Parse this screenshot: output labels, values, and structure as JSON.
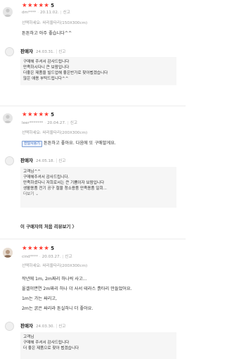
{
  "reviews": [
    {
      "stars": "★★★★★",
      "rating": "5",
      "user": "dm****",
      "date": "20.11.02.",
      "report": "신고",
      "option": "선택하세요: 싸리울타리(150X300cm)",
      "body": "튼튼하고 아주 좋습니다^^",
      "reply": {
        "seller": "판매자",
        "date": "24.03.31.",
        "report": "신고",
        "lines": [
          "구매해 주셔서 감사드립니다",
          "만족하시다니 큰 보람입니다",
          "더좋은 제품을 빌드업해 좋은반가로 찾아뵙겠습니다",
          "많은 애용 부탁드립니다^^"
        ]
      }
    },
    {
      "stars": "★★★★★",
      "rating": "5",
      "user": "leer*******",
      "date": "20.04.27.",
      "report": "신고",
      "option": "선택하세요: 싸리울타리(200X300cm)",
      "badge": "한달사용기",
      "body": "튼튼하고 좋아요. 다음에 또 구매할게요.",
      "reply": {
        "seller": "판매자",
        "date": "24.05.18.",
        "report": "신고",
        "lines": [
          "고객님^^",
          "구매해주셔서 감사드립니다.",
          "만족하셨다니 저희로서는 큰 기쁨이자 보람입니다",
          "생활용품 전기 공구 철물 청소용품 만족용품 일회..."
        ],
        "more": "더보기 ⌄"
      },
      "first_review_link": "이 구매자의 처음 리뷰보기 〉"
    },
    {
      "stars": "★★★★★",
      "rating": "5",
      "user": "cind****",
      "date": "20.03.27.",
      "report": "신고",
      "option": "선택하세요: 싸리울타리(200X300cm)",
      "body_lines": [
        "작년에 1m, 2m짜리 하나씩 사고...",
        "올겔이면연  2m짜리 하나 더 사서 테라스 흙타리 만들었어요.",
        "1m는 가는 싸리고,",
        "  2m는 굵은 싸리라 튼실하니 더 좋아요."
      ],
      "reply": {
        "seller": "판매자",
        "date": "24.03.30.",
        "report": "신고",
        "lines": [
          "고객님",
          "구매해 주셔서 감사드립니다",
          "더 좋은 제품으로 찾아 뵙겠습니다"
        ]
      }
    }
  ]
}
